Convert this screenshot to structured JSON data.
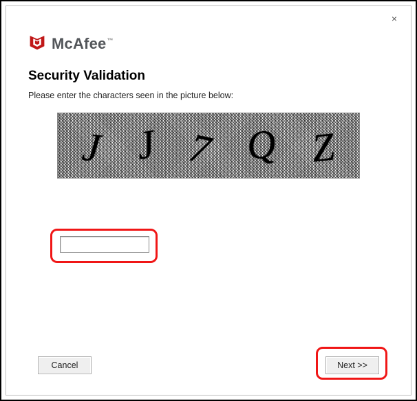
{
  "brand": {
    "name": "McAfee",
    "tm": "™",
    "logo_color": "#c01818"
  },
  "window": {
    "close_glyph": "×"
  },
  "page": {
    "heading": "Security Validation",
    "instruction": "Please enter the characters seen in the picture below:"
  },
  "captcha": {
    "chars": [
      "J",
      "J",
      "7",
      "Q",
      "Z"
    ],
    "input_value": ""
  },
  "buttons": {
    "cancel": "Cancel",
    "next": "Next >>"
  }
}
